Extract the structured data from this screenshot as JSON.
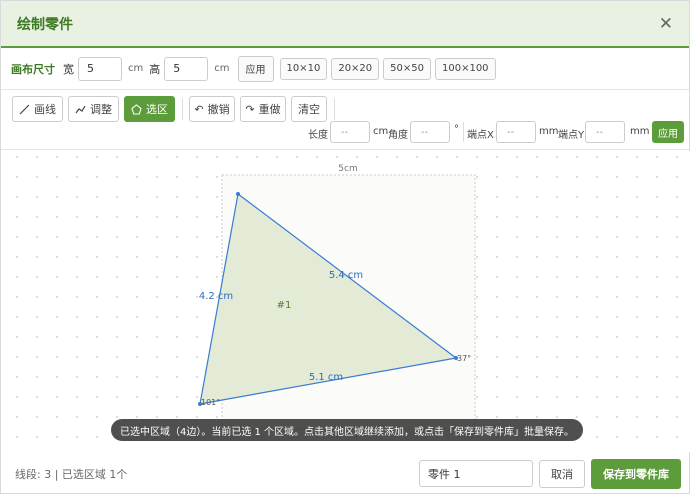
{
  "dialog": {
    "title": "绘制零件"
  },
  "canvas_size": {
    "label": "画布尺寸",
    "width_label": "宽",
    "width_value": "5",
    "width_unit": "cm",
    "height_label": "高",
    "height_value": "5",
    "height_unit": "cm",
    "apply_label": "应用",
    "presets": [
      "10×10",
      "20×20",
      "50×50",
      "100×100"
    ]
  },
  "tools": {
    "draw_line": "画线",
    "adjust": "调整",
    "select": "选区",
    "undo": "撤销",
    "redo": "重做",
    "clear": "清空"
  },
  "props": {
    "length_label": "长度",
    "length_value": "--",
    "length_unit": "cm",
    "angle_label": "角度",
    "angle_value": "--",
    "angle_unit": "°",
    "vx_label": "端点X",
    "vx_value": "--",
    "vx_unit": "mm",
    "vy_label": "端点Y",
    "vy_value": "--",
    "vy_unit": "mm",
    "apply_label": "应用"
  },
  "drawing": {
    "board_label": "5cm",
    "edge_labels": [
      "4.2 cm",
      "5.4 cm",
      "5.1 cm"
    ],
    "region_label": "#1",
    "angle_labels": [
      "101°",
      "37°"
    ],
    "accent_color": "#3a7bd5",
    "fill_color": "#e3ebd6"
  },
  "toast": "已选中区域（4边）。当前已选 1 个区域。点击其他区域继续添加，或点击「保存到零件库」批量保存。",
  "footer": {
    "status": "线段: 3 | 已选区域 1个",
    "part_name": "零件 1",
    "cancel_label": "取消",
    "save_label": "保存到零件库"
  }
}
